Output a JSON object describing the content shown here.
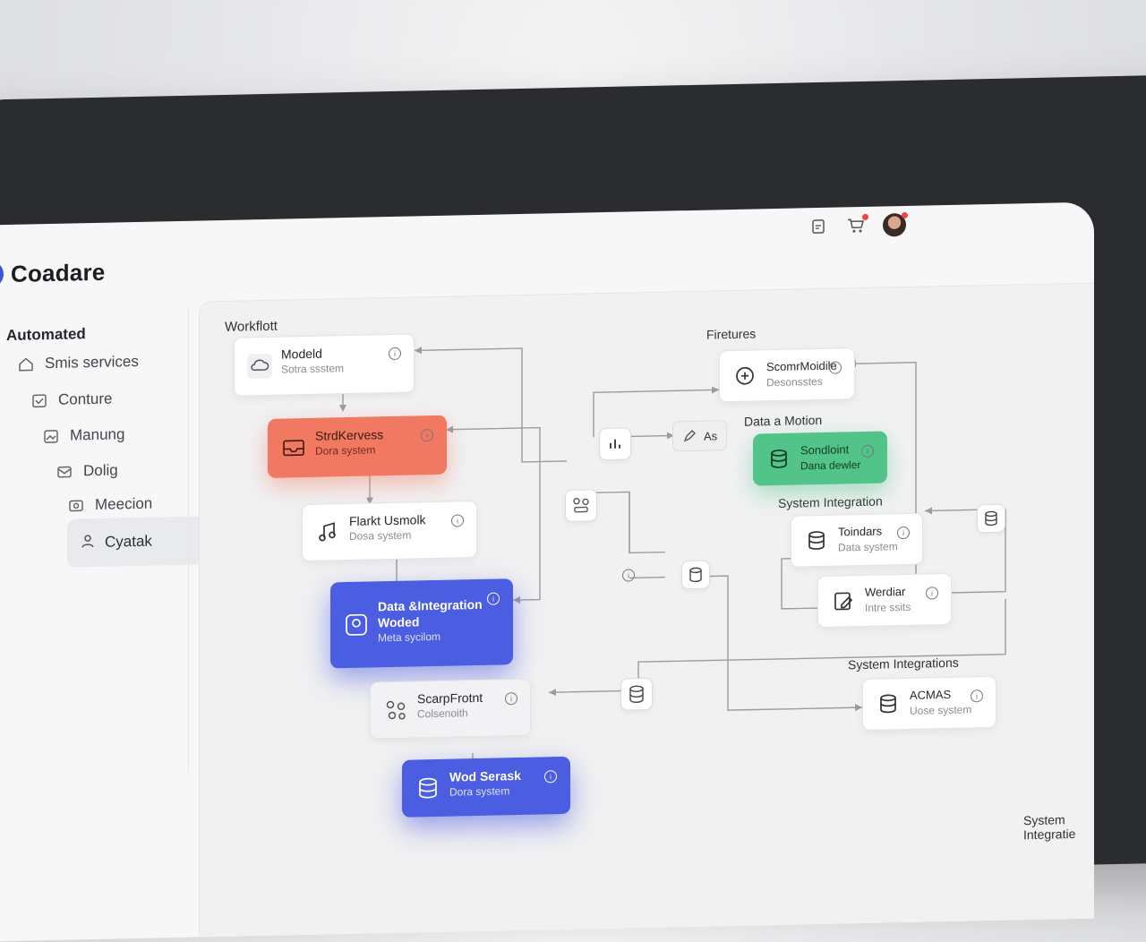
{
  "app": {
    "name": "Coadare"
  },
  "topbar": {
    "icons": [
      "document-icon",
      "cart-icon",
      "avatar"
    ]
  },
  "sidebar": {
    "heading": "Automated",
    "items": [
      {
        "label": "Smis services",
        "icon": "home-icon"
      },
      {
        "label": "Conture",
        "icon": "inbox-icon"
      },
      {
        "label": "Manung",
        "icon": "image-icon"
      },
      {
        "label": "Dolig",
        "icon": "mail-icon"
      },
      {
        "label": "Meecion",
        "icon": "media-icon"
      }
    ],
    "selected": {
      "label": "Cyatak",
      "icon": "user-icon"
    }
  },
  "workflow": {
    "title": "Workflott",
    "section_labels": {
      "features": "Firetures",
      "data_motion": "Data a Motion",
      "system_integration": "System Integration",
      "system_integrations": "System Integrations",
      "footer": "System Integratie"
    },
    "cards": {
      "modeld": {
        "title": "Modeld",
        "subtitle": "Sotra ssstem"
      },
      "stratkervess": {
        "title": "StrdKervess",
        "subtitle": "Dora system"
      },
      "flank": {
        "title": "Flarkt Usmolk",
        "subtitle": "Dosa system"
      },
      "data_integration": {
        "title": "Data &Integration",
        "title2": "Woded",
        "subtitle": "Meta sycilom"
      },
      "scrapfront": {
        "title": "ScarpFrotnt",
        "subtitle": "Colsenoith"
      },
      "wod_serask": {
        "title": "Wod Serask",
        "subtitle": "Dora system"
      },
      "scomm": {
        "title": "ScomrMoidile",
        "subtitle": "Desonsstes"
      },
      "sandoint": {
        "title": "Sondloint",
        "subtitle": "Dana dewler"
      },
      "toinders": {
        "title": "Toindars",
        "subtitle": "Data system"
      },
      "wondar": {
        "title": "Werdiar",
        "subtitle": "Intre ssits"
      },
      "acmas": {
        "title": "ACMAS",
        "subtitle": "Uose system"
      }
    },
    "chip": {
      "label": "As"
    },
    "colors": {
      "red": "#f27961",
      "green": "#52c489",
      "blue": "#4b5de0"
    }
  }
}
